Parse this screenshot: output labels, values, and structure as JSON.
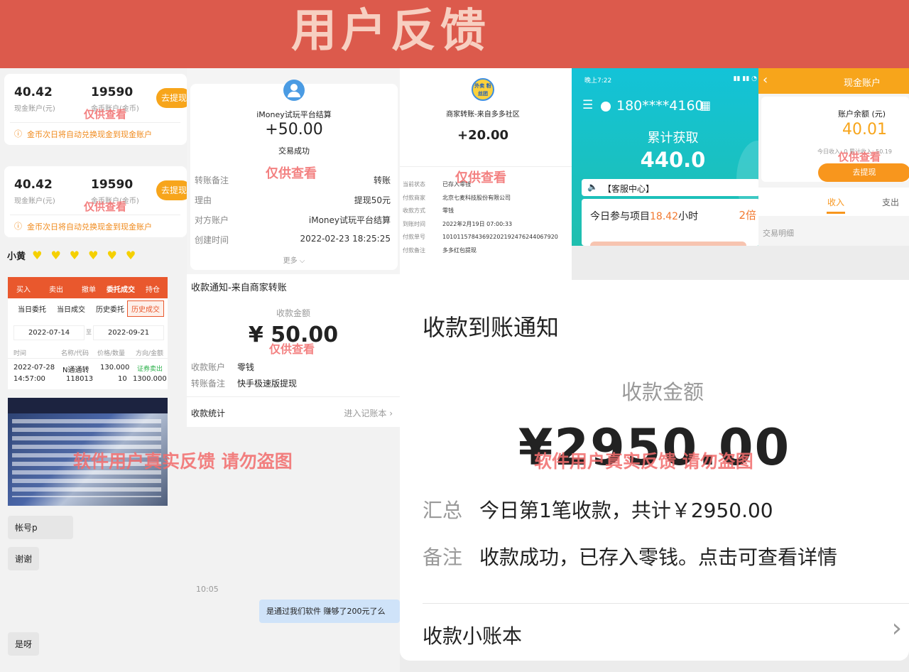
{
  "banner": {
    "title": "用户反馈"
  },
  "watermark": {
    "short": "仅供查看",
    "long": "软件用户真实反馈  请勿盗图"
  },
  "gold_cards": [
    {
      "cash": "40.42",
      "cash_label": "现金账户(元)",
      "coins": "19590",
      "coins_label": "金币账户(金币)",
      "button": "去提现",
      "tip": "金币次日将自动兑换现金到现金账户"
    },
    {
      "cash": "40.42",
      "cash_label": "现金账户(元)",
      "coins": "19590",
      "coins_label": "金币账户(金币)",
      "button": "去提现",
      "tip": "金币次日将自动兑换现金到现金账户"
    }
  ],
  "stock": {
    "user": "小黄",
    "tabs": [
      "买入",
      "卖出",
      "撤单",
      "委托成交",
      "持仓"
    ],
    "subtabs": [
      "当日委托",
      "当日成交",
      "历史委托",
      "历史成交"
    ],
    "date_from": "2022-07-14",
    "date_sep": "至",
    "date_to": "2022-09-21",
    "headers": [
      "时间",
      "名称/代码",
      "价格/数量",
      "方向/金额"
    ],
    "row": {
      "date": "2022-07-28",
      "time": "14:57:00",
      "name": "N通通转",
      "code": "118013",
      "price": "130.000",
      "qty": "10",
      "dir": "证券卖出",
      "amount": "1300.000"
    }
  },
  "chat_left": {
    "account": "帐号p",
    "thanks": "谢谢",
    "yes": "是呀"
  },
  "imoney": {
    "title": "iMoney试玩平台结算",
    "amount": "+50.00",
    "status": "交易成功",
    "rows": [
      {
        "label": "转账备注",
        "value": "转账"
      },
      {
        "label": "理由",
        "value": "提现50元"
      },
      {
        "label": "对方账户",
        "value": "iMoney试玩平台结算"
      },
      {
        "label": "创建时间",
        "value": "2022-02-23 18:25:25"
      }
    ],
    "more": "更多"
  },
  "receipt_small": {
    "title": "收款通知-来自商家转账",
    "amount_label": "收款金额",
    "amount": "¥ 50.00",
    "rows": [
      {
        "label": "收款账户",
        "value": "零钱"
      },
      {
        "label": "转账备注",
        "value": "快手极速版提现"
      }
    ],
    "stats": "收款统计",
    "ledger": "进入记账本"
  },
  "chat_mid": {
    "time": "10:05",
    "message": "是通过我们软件 赚够了200元了么"
  },
  "merchant": {
    "logo": "外卖 粉丝团",
    "title": "商家转账-来自多多社区",
    "amount": "+20.00",
    "rows": [
      {
        "label": "当前状态",
        "value": "已存入零钱"
      },
      {
        "label": "付款商家",
        "value": "北京七麦科技股份有限公司"
      },
      {
        "label": "收款方式",
        "value": "零钱"
      },
      {
        "label": "到账时间",
        "value": "2022年2月19日 07:00:33"
      },
      {
        "label": "付款单号",
        "value": "1010115784369220219247624406792​0"
      },
      {
        "label": "付款备注",
        "value": "多多红包提现"
      }
    ]
  },
  "phone": {
    "status_time": "晚上7:22",
    "user": "180****4160",
    "earned_label": "累计获取",
    "earned": "440.0",
    "service": "【客服中心】",
    "today": "今日参与项目",
    "hours": "18.42",
    "hours_unit": "小时",
    "multiplier": "2倍"
  },
  "cash_account": {
    "title": "现金账户",
    "balance_label": "账户余额 (元)",
    "balance": "40.01",
    "today_income": "今日收入: 0",
    "total": "累计收入: 50.19",
    "button": "去提现",
    "tab_income": "收入",
    "tab_expense": "支出",
    "detail": "交易明细"
  },
  "big_receipt": {
    "title": "收款到账通知",
    "amount_label": "收款金额",
    "amount": "¥2950.00",
    "summary_label": "汇总",
    "summary": "今日第1笔收款，共计￥2950.00",
    "note_label": "备注",
    "note": "收款成功，已存入零钱。点击可查看详情",
    "ledger": "收款小账本"
  },
  "colors": {
    "banner": "#dc5a4c",
    "orange": "#f7a51b",
    "teal": "#13c3d8",
    "stock_red": "#e9582d"
  }
}
